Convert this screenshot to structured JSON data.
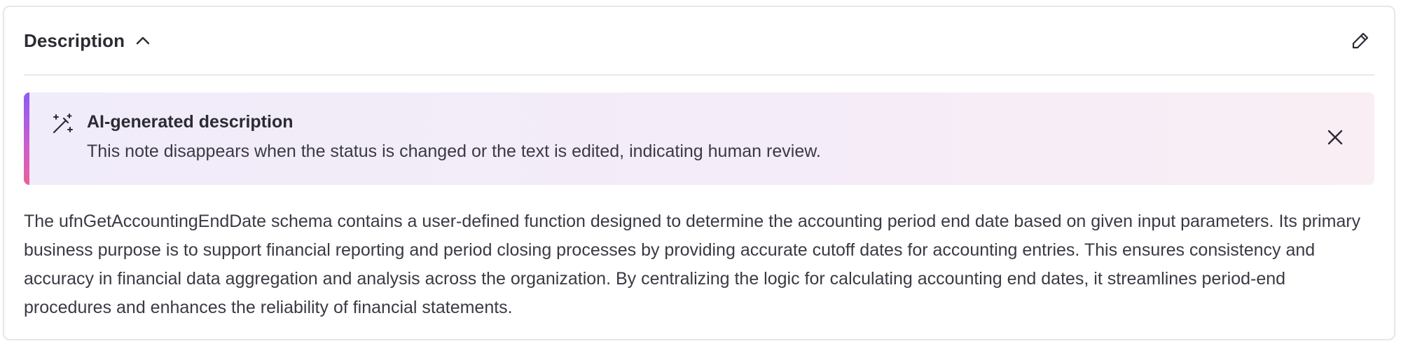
{
  "section": {
    "title": "Description",
    "collapse_icon": "chevron-up-icon",
    "edit_icon": "pencil-icon"
  },
  "ai_notice": {
    "icon": "magic-wand-icon",
    "title": "AI-generated description",
    "text": "This note disappears when the status is changed or the text is edited, indicating human review.",
    "close_icon": "close-icon",
    "accent_colors": [
      "#8a5cf6",
      "#ec5f9a"
    ]
  },
  "description": {
    "text": "The ufnGetAccountingEndDate schema contains a user-defined function designed to determine the accounting period end date based on given input parameters. Its primary business purpose is to support financial reporting and period closing processes by providing accurate cutoff dates for accounting entries. This ensures consistency and accuracy in financial data aggregation and analysis across the organization. By centralizing the logic for calculating accounting end dates, it streamlines period-end procedures and enhances the reliability of financial statements."
  }
}
